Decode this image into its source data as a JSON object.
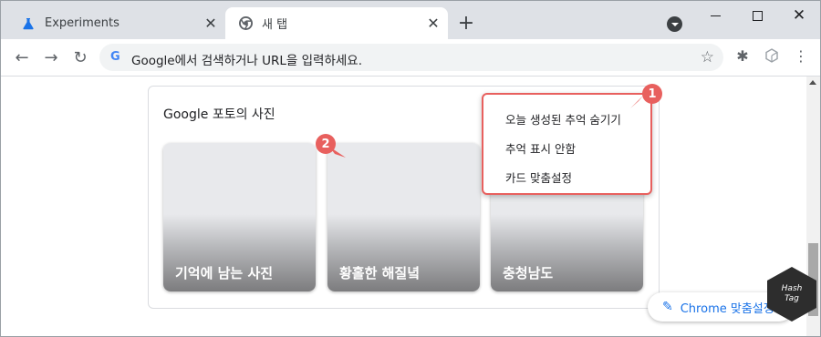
{
  "tabs": [
    {
      "title": "Experiments",
      "icon": "flask-icon",
      "active": false
    },
    {
      "title": "새 탭",
      "icon": "chrome-icon",
      "active": true
    }
  ],
  "tab_close_glyph": "✕",
  "new_tab_glyph": "+",
  "window": {
    "close_glyph": "✕"
  },
  "toolbar": {
    "back_glyph": "←",
    "forward_glyph": "→",
    "reload_glyph": "↻",
    "omnibox_logo": "G",
    "omnibox_placeholder": "Google에서 검색하거나 URL을 입력하세요.",
    "star_glyph": "☆",
    "extensions_glyph": "✱",
    "menu_glyph": "⋮"
  },
  "card": {
    "title": "Google 포토의 사진",
    "photos": [
      {
        "label": "기억에 남는 사진"
      },
      {
        "label": "황홀한 해질녘"
      },
      {
        "label": "충청남도"
      }
    ]
  },
  "menu": {
    "items": [
      {
        "label": "오늘 생성된 추억 숨기기"
      },
      {
        "label": "추억 표시 안함"
      },
      {
        "label": "카드 맞춤설정"
      }
    ]
  },
  "badges": {
    "one": "1",
    "two": "2"
  },
  "customize_button": {
    "label": "Chrome 맞춤설정",
    "icon_glyph": "✎"
  },
  "watermark": {
    "line1": "Hash",
    "line2": "Tag"
  },
  "colors": {
    "accent": "#1a73e8",
    "annotation": "#e8605e"
  }
}
